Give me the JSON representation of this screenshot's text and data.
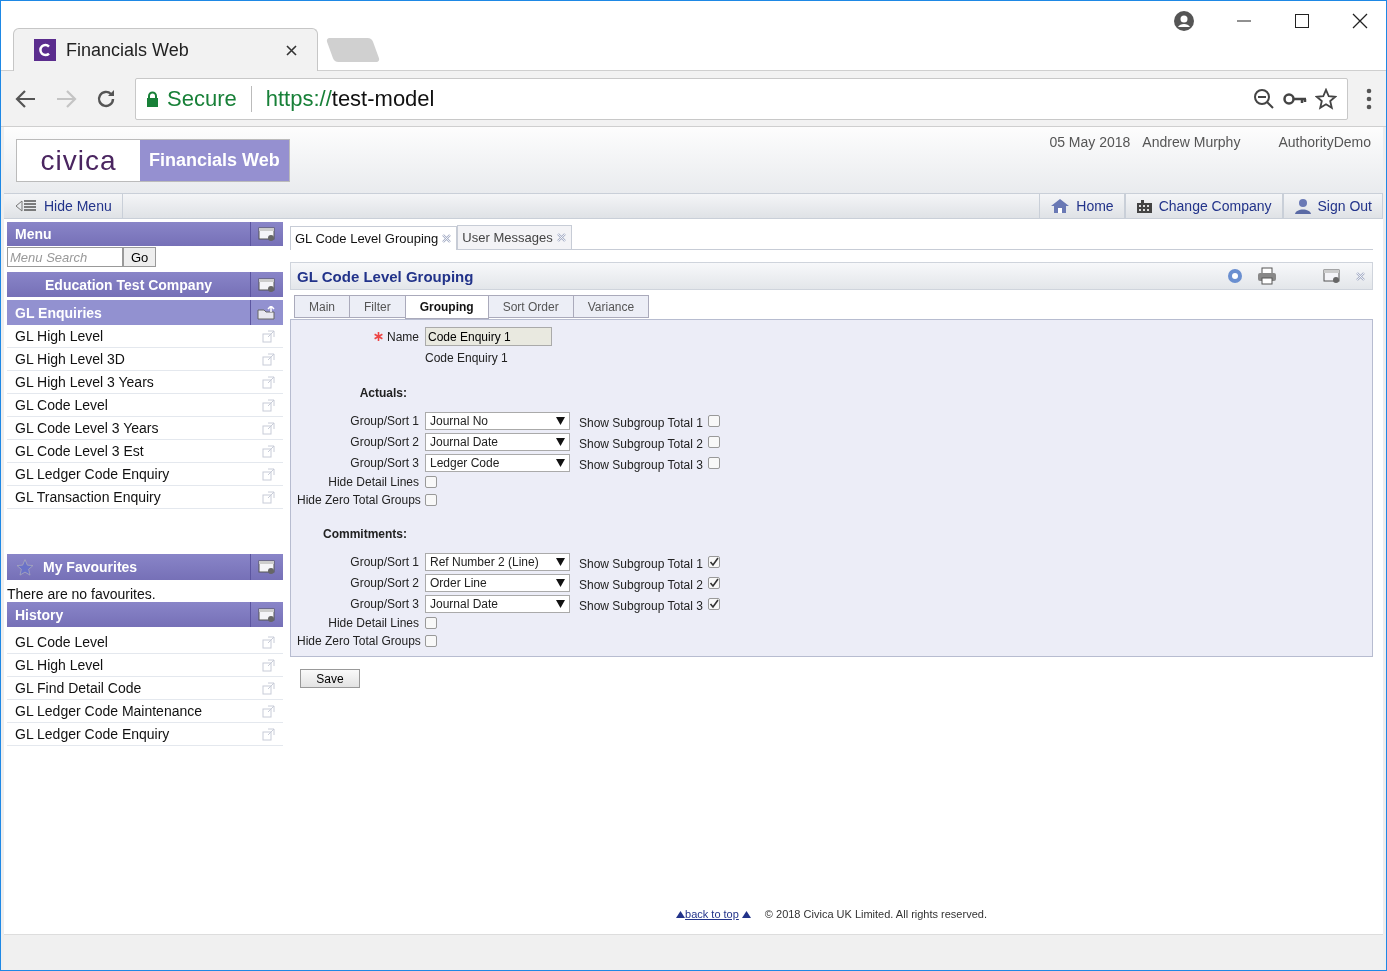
{
  "browser": {
    "tab_title": "Financials Web",
    "secure_label": "Secure",
    "url_scheme": "https://",
    "url_host": "test-model"
  },
  "header": {
    "logo": "civica",
    "app_name": "Financials Web",
    "date": "05 May 2018",
    "user": "Andrew Murphy",
    "authority": "AuthorityDemo"
  },
  "navbar": {
    "hide_menu": "Hide Menu",
    "links": [
      {
        "kind": "home",
        "label": "Home"
      },
      {
        "kind": "company",
        "label": "Change Company"
      },
      {
        "kind": "signout",
        "label": "Sign Out"
      }
    ]
  },
  "sidebar": {
    "menu_title": "Menu",
    "search": {
      "placeholder": "Menu Search"
    },
    "go": "Go",
    "company": "Education Test Company",
    "section": "GL Enquiries",
    "items": [
      "GL High Level",
      "GL High Level 3D",
      "GL High Level 3 Years",
      "GL Code Level",
      "GL Code Level 3 Years",
      "GL Code Level 3 Est",
      "GL Ledger Code Enquiry",
      "GL Transaction Enquiry"
    ],
    "favourites_title": "My Favourites",
    "favourites_empty": "There are no favourites.",
    "history_title": "History",
    "history": [
      "GL Code Level",
      "GL High Level",
      "GL Find Detail Code",
      "GL Ledger Code Maintenance",
      "GL Ledger Code Enquiry"
    ]
  },
  "doc_tabs": [
    {
      "label": "GL Code Level Grouping",
      "selected": true
    },
    {
      "label": "User Messages",
      "selected": false
    }
  ],
  "panel": {
    "title": "GL Code Level Grouping",
    "tabs": [
      {
        "label": "Main",
        "selected": false
      },
      {
        "label": "Filter",
        "selected": false
      },
      {
        "label": "Grouping",
        "selected": true
      },
      {
        "label": "Sort Order",
        "selected": false
      },
      {
        "label": "Variance",
        "selected": false
      }
    ],
    "name_label": "Name",
    "required": true,
    "name_value": "Code Enquiry 1",
    "name_description": "Code Enquiry 1",
    "sections": [
      {
        "title": "Actuals:",
        "sorts": [
          {
            "label": "Group/Sort 1",
            "value": "Journal No",
            "subtotal_label": "Show Subgroup Total 1",
            "checked": false
          },
          {
            "label": "Group/Sort 2",
            "value": "Journal Date",
            "subtotal_label": "Show Subgroup Total 2",
            "checked": false
          },
          {
            "label": "Group/Sort 3",
            "value": "Ledger Code",
            "subtotal_label": "Show Subgroup Total 3",
            "checked": false
          }
        ],
        "options": [
          {
            "label": "Hide Detail Lines",
            "checked": false
          },
          {
            "label": "Hide Zero Total Groups",
            "checked": false
          }
        ]
      },
      {
        "title": "Commitments:",
        "sorts": [
          {
            "label": "Group/Sort 1",
            "value": "Ref Number 2 (Line)",
            "subtotal_label": "Show Subgroup Total 1",
            "checked": true
          },
          {
            "label": "Group/Sort 2",
            "value": "Order Line",
            "subtotal_label": "Show Subgroup Total 2",
            "checked": true
          },
          {
            "label": "Group/Sort 3",
            "value": "Journal Date",
            "subtotal_label": "Show Subgroup Total 3",
            "checked": true
          }
        ],
        "options": [
          {
            "label": "Hide Detail Lines",
            "checked": false
          },
          {
            "label": "Hide Zero Total Groups",
            "checked": false
          }
        ]
      }
    ],
    "save": "Save"
  },
  "footer": {
    "back_to_top": "back to top",
    "copyright": "© 2018 Civica UK Limited. All rights reserved."
  }
}
